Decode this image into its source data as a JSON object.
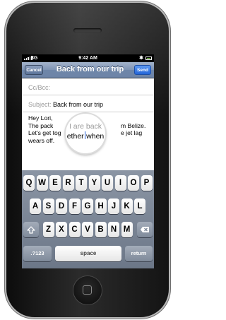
{
  "status_bar": {
    "carrier": "3G",
    "time": "9:42 AM",
    "bluetooth_icon": "bluetooth-icon",
    "battery_color": "#7fd14b"
  },
  "nav": {
    "cancel_label": "Cancel",
    "title": "Back from our trip",
    "send_label": "Send"
  },
  "fields": {
    "cc_label": "Cc/Bcc:",
    "subject_label": "Subject:",
    "subject_value": "Back from our trip"
  },
  "body_lines": [
    "Hey Lori,",
    "The pack",
    "m Belize.",
    "Let's get tog",
    "e jet lag",
    "wears off."
  ],
  "magnifier": {
    "line1": "I are back",
    "line2_before": "ether",
    "line2_after": "when"
  },
  "keyboard": {
    "row1": [
      "Q",
      "W",
      "E",
      "R",
      "T",
      "Y",
      "U",
      "I",
      "O",
      "P"
    ],
    "row2": [
      "A",
      "S",
      "D",
      "F",
      "G",
      "H",
      "J",
      "K",
      "L"
    ],
    "row3": [
      "Z",
      "X",
      "C",
      "V",
      "B",
      "N",
      "M"
    ],
    "shift_icon": "shift-arrow-icon",
    "delete_icon": "delete-backspace-icon",
    "numbers_label": ".?123",
    "space_label": "space",
    "return_label": "return"
  }
}
